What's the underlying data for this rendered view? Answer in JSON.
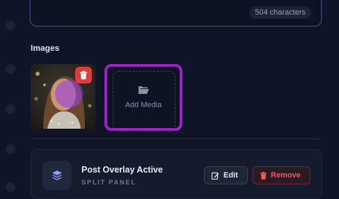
{
  "description": {
    "char_count": "504 characters"
  },
  "images": {
    "section_title": "Images",
    "add_media_label": "Add Media"
  },
  "overlay": {
    "title": "Post Overlay Active",
    "subtitle": "SPLIT PANEL",
    "edit_label": "Edit",
    "remove_label": "Remove"
  },
  "colors": {
    "background": "#0f1526",
    "highlight": "#a21fd0",
    "danger": "#e23b3b",
    "accent_border": "#3c4690"
  },
  "icons": {
    "folder": "folder-open-icon",
    "trash": "trash-icon",
    "layers": "layers-icon",
    "edit": "edit-icon"
  }
}
